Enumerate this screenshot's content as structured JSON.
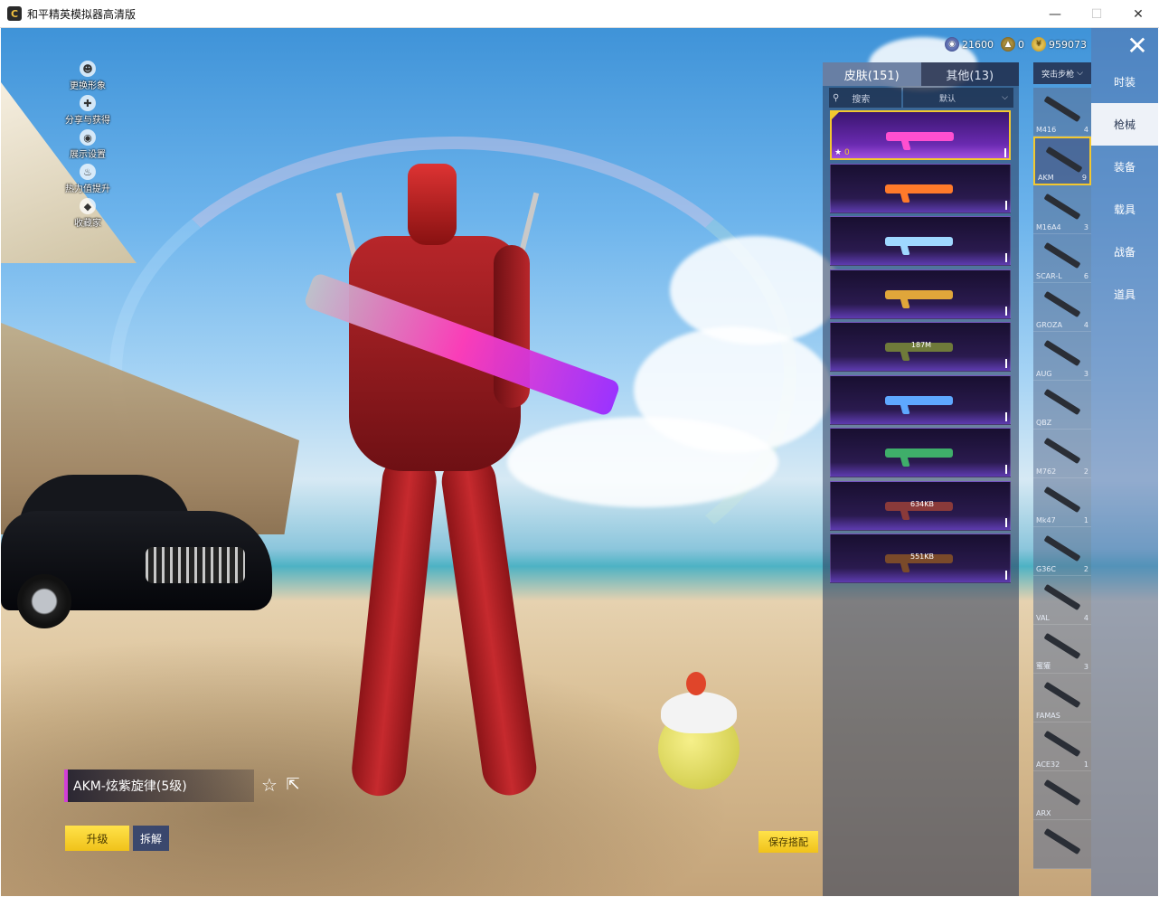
{
  "window": {
    "title": "和平精英模拟器高清版",
    "logo_glyph": "C",
    "minimize_glyph": "—",
    "maximize_glyph": "☐",
    "close_glyph": "✕"
  },
  "currency": {
    "item1": "21600",
    "item2": "0",
    "item3": "959073",
    "icon1": "premium-currency-icon",
    "icon2": "coupon-currency-icon",
    "icon3": "coin-currency-icon"
  },
  "left_menu": [
    {
      "label": "更换形象",
      "icon": "person-icon"
    },
    {
      "label": "分享与获得",
      "icon": "share-icon"
    },
    {
      "label": "展示设置",
      "icon": "eye-icon"
    },
    {
      "label": "热力值提升",
      "icon": "flame-icon"
    },
    {
      "label": "收藏家",
      "icon": "collector-icon"
    }
  ],
  "skin": {
    "name": "AKM-炫紫旋律(5级)",
    "star_glyph": "☆",
    "share_glyph": "⇱"
  },
  "buttons": {
    "upgrade": "升级",
    "dismantle": "拆解",
    "save_outfit": "保存搭配"
  },
  "panel": {
    "tab_skins": "皮肤(151)",
    "tab_other": "其他(13)",
    "search_placeholder": "搜索",
    "sort_label": "默认",
    "search_glyph": "⚲",
    "sort_glyph": "⌵"
  },
  "skins": [
    {
      "color": "#ff4fd0",
      "selected": true,
      "fav_count": "0",
      "download": ""
    },
    {
      "color": "#ff7a2a",
      "selected": false,
      "fav_count": "",
      "download": ""
    },
    {
      "color": "#9fd8ff",
      "selected": false,
      "fav_count": "",
      "download": ""
    },
    {
      "color": "#e0a63a",
      "selected": false,
      "fav_count": "",
      "download": ""
    },
    {
      "color": "#6f7a3a",
      "selected": false,
      "fav_count": "",
      "download": "187M"
    },
    {
      "color": "#5ea8ff",
      "selected": false,
      "fav_count": "",
      "download": ""
    },
    {
      "color": "#3fae6a",
      "selected": false,
      "fav_count": "",
      "download": ""
    },
    {
      "color": "#8a3a3a",
      "selected": false,
      "fav_count": "",
      "download": "634KB"
    },
    {
      "color": "#7a4a2a",
      "selected": false,
      "fav_count": "",
      "download": "551KB"
    }
  ],
  "weapon_filter": {
    "label": "突击步枪",
    "glyph": "⌵"
  },
  "weapons": [
    {
      "name": "M416",
      "count": "4",
      "selected": false
    },
    {
      "name": "AKM",
      "count": "9",
      "selected": true
    },
    {
      "name": "M16A4",
      "count": "3",
      "selected": false
    },
    {
      "name": "SCAR-L",
      "count": "6",
      "selected": false
    },
    {
      "name": "GROZA",
      "count": "4",
      "selected": false
    },
    {
      "name": "AUG",
      "count": "3",
      "selected": false
    },
    {
      "name": "QBZ",
      "count": "",
      "selected": false
    },
    {
      "name": "M762",
      "count": "2",
      "selected": false
    },
    {
      "name": "Mk47",
      "count": "1",
      "selected": false
    },
    {
      "name": "G36C",
      "count": "2",
      "selected": false
    },
    {
      "name": "VAL",
      "count": "4",
      "selected": false
    },
    {
      "name": "蜜獾",
      "count": "3",
      "selected": false
    },
    {
      "name": "FAMAS",
      "count": "",
      "selected": false
    },
    {
      "name": "ACE32",
      "count": "1",
      "selected": false
    },
    {
      "name": "ARX",
      "count": "",
      "selected": false
    },
    {
      "name": "",
      "count": "",
      "selected": false
    }
  ],
  "categories": [
    {
      "label": "时装",
      "active": false
    },
    {
      "label": "枪械",
      "active": true
    },
    {
      "label": "装备",
      "active": false
    },
    {
      "label": "载具",
      "active": false
    },
    {
      "label": "战备",
      "active": false
    },
    {
      "label": "道具",
      "active": false
    }
  ],
  "close_glyph": "✕"
}
